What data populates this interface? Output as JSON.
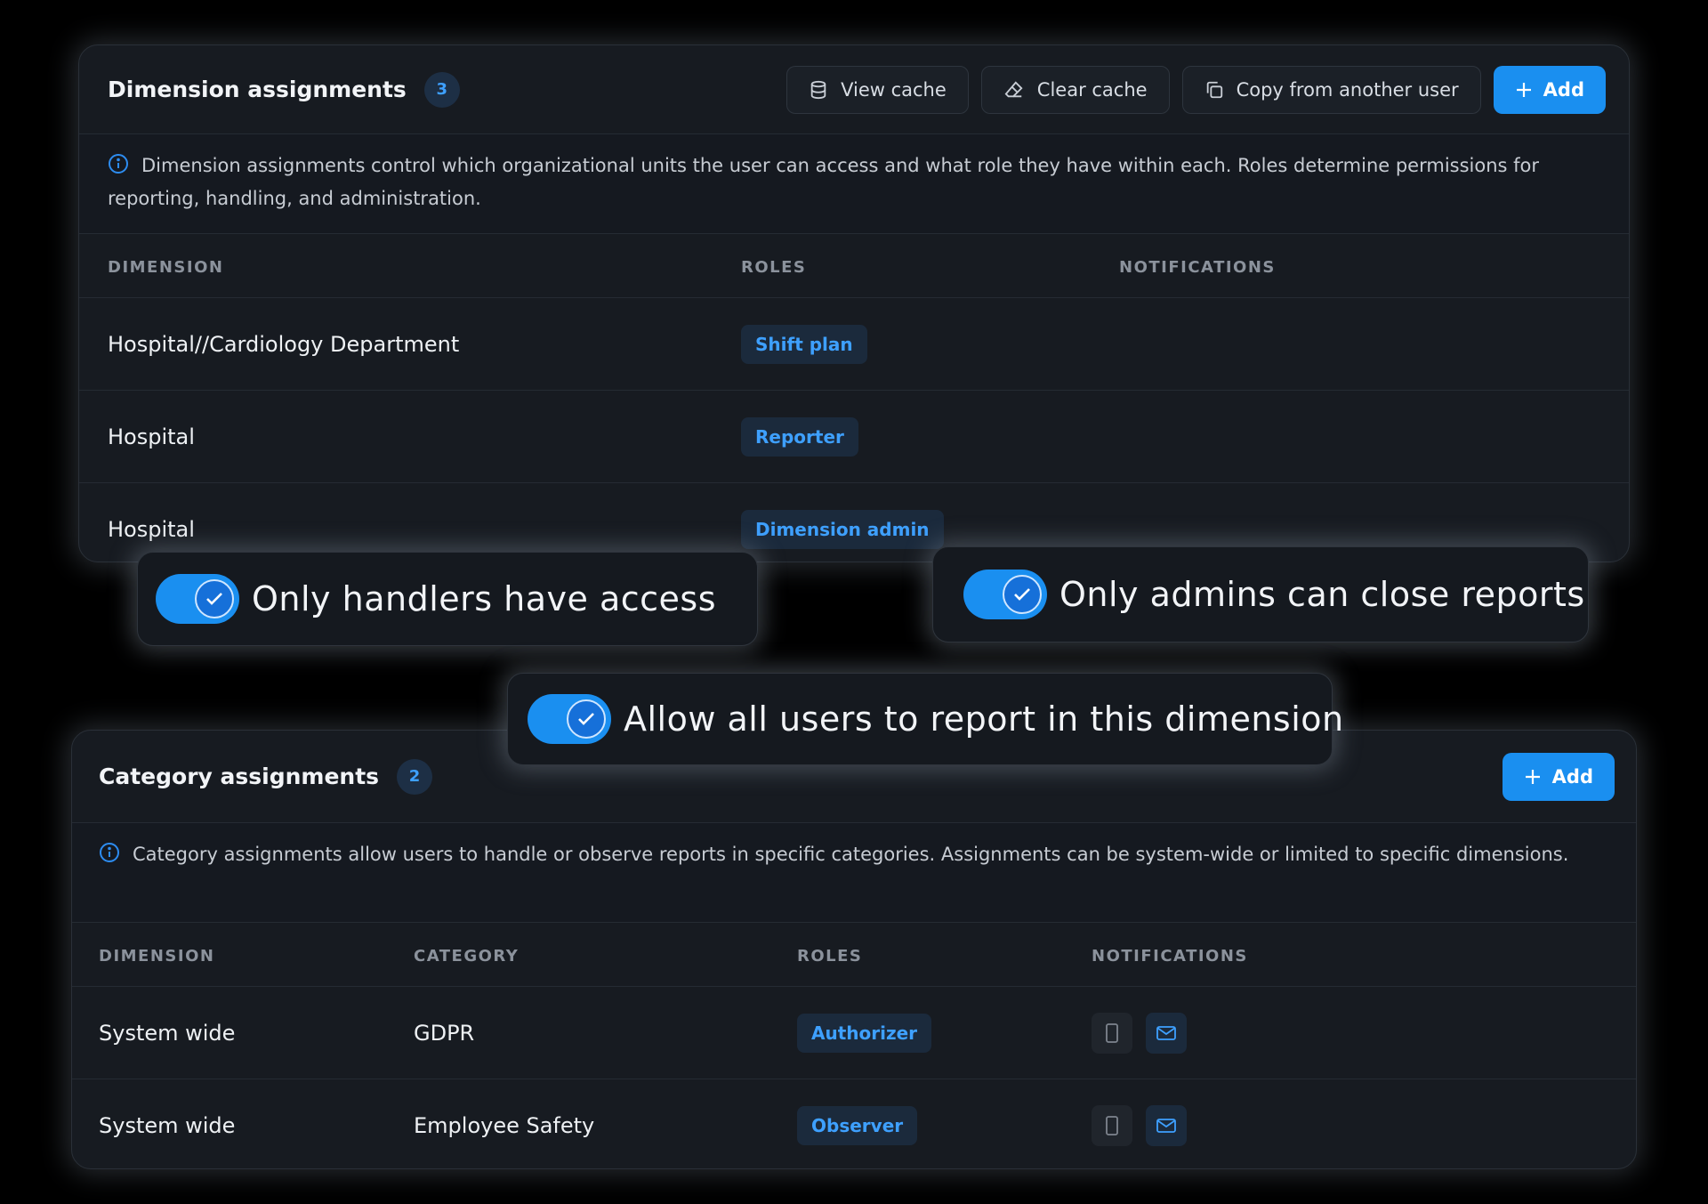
{
  "dimension_panel": {
    "title": "Dimension assignments",
    "count": "3",
    "actions": {
      "view_cache": "View cache",
      "clear_cache": "Clear cache",
      "copy_from_user": "Copy from another user",
      "add": "Add"
    },
    "info": "Dimension assignments control which organizational units the user can access and what role they have within each. Roles determine permissions for reporting, handling, and administration.",
    "columns": [
      "DIMENSION",
      "ROLES",
      "NOTIFICATIONS"
    ],
    "rows": [
      {
        "dimension": "Hospital//Cardiology Department",
        "role": "Shift plan"
      },
      {
        "dimension": "Hospital",
        "role": "Reporter"
      },
      {
        "dimension": "Hospital",
        "role": "Dimension admin"
      }
    ]
  },
  "toggles": [
    {
      "label": "Only handlers have access",
      "on": true
    },
    {
      "label": "Only admins can close reports",
      "on": true
    },
    {
      "label": "Allow all users to report in this dimension",
      "on": true
    }
  ],
  "category_panel": {
    "title": "Category assignments",
    "count": "2",
    "actions": {
      "add": "Add"
    },
    "info": "Category assignments allow users to handle or observe reports in specific categories. Assignments can be system-wide or limited to specific dimensions.",
    "columns": [
      "DIMENSION",
      "CATEGORY",
      "ROLES",
      "NOTIFICATIONS"
    ],
    "rows": [
      {
        "dimension": "System wide",
        "category": "GDPR",
        "role": "Authorizer",
        "notifications": [
          "phone-icon",
          "mail-icon"
        ]
      },
      {
        "dimension": "System wide",
        "category": "Employee Safety",
        "role": "Observer",
        "notifications": [
          "phone-icon",
          "mail-icon"
        ]
      }
    ]
  },
  "colors": {
    "accent": "#1a8ff0",
    "role_text": "#3ea0ff",
    "panel_bg": "#171b21",
    "page_bg": "#000000"
  }
}
